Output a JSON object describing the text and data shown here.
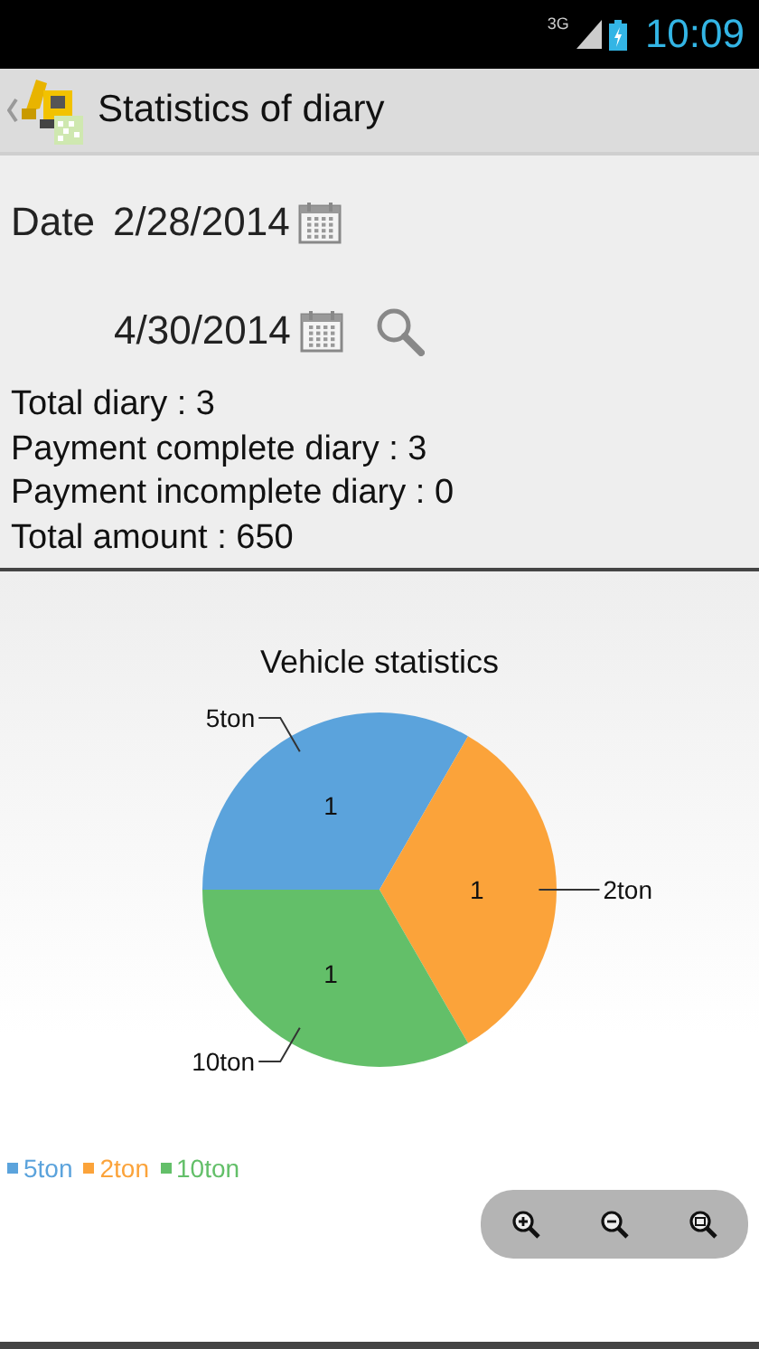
{
  "status_bar": {
    "time": "10:09",
    "network": "3G"
  },
  "action_bar": {
    "title": "Statistics of diary"
  },
  "date_filter": {
    "label": "Date",
    "from": "2/28/2014",
    "to": "4/30/2014"
  },
  "summary": [
    "Total diary : 3",
    "Payment complete diary : 3",
    "Payment incomplete diary : 0",
    "Total amount : 650"
  ],
  "chart": {
    "chart_data": {
      "type": "pie",
      "title": "Vehicle statistics",
      "categories": [
        "5ton",
        "2ton",
        "10ton"
      ],
      "values": [
        1,
        1,
        1
      ],
      "data_labels": true
    },
    "legend": [
      {
        "label": "5ton",
        "color": "#5ba3dc"
      },
      {
        "label": "2ton",
        "color": "#fba33a"
      },
      {
        "label": "10ton",
        "color": "#63bf69"
      }
    ]
  }
}
